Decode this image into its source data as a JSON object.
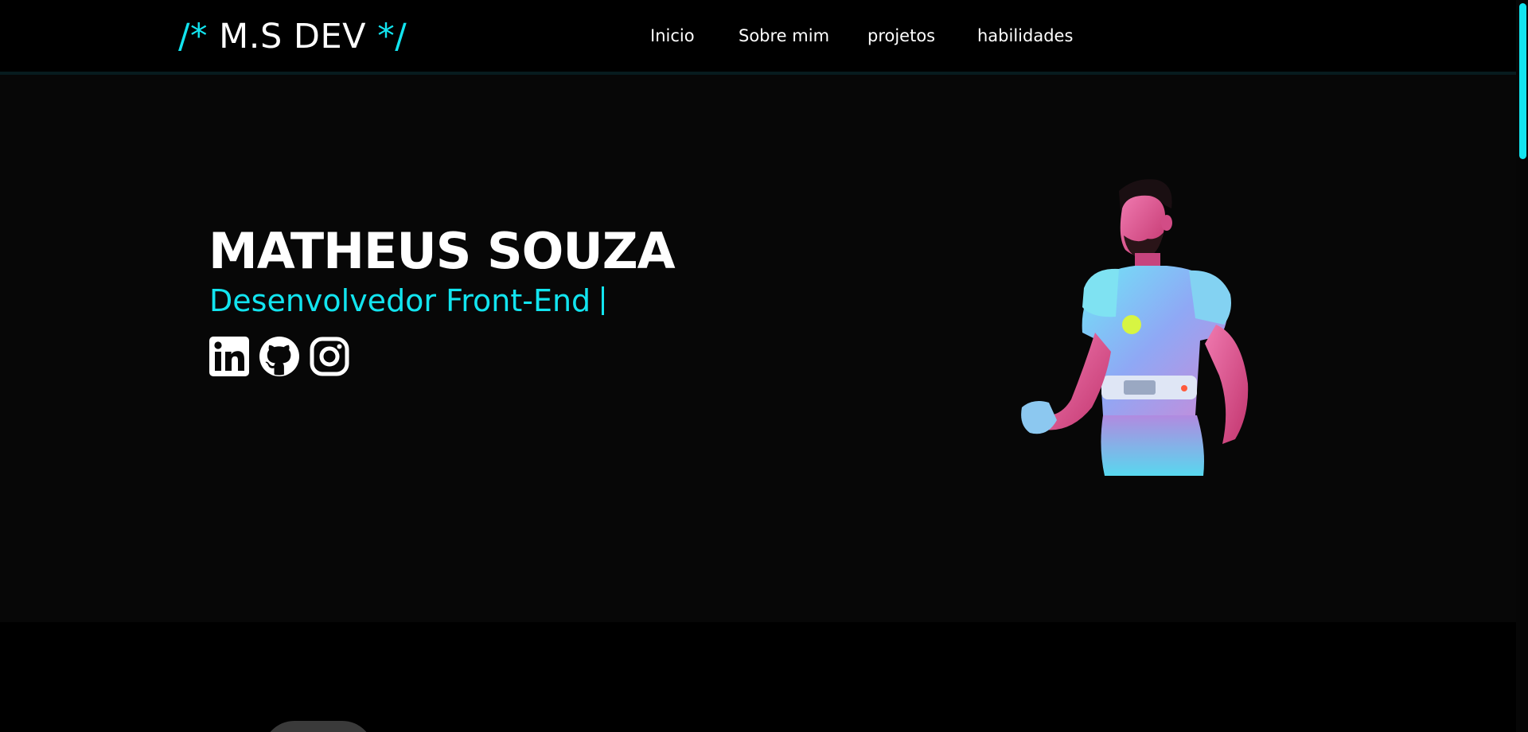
{
  "header": {
    "logo_open": "/*",
    "logo_text": "M.S DEV",
    "logo_close": "*/"
  },
  "nav": {
    "items": [
      {
        "label": "Inicio"
      },
      {
        "label": "Sobre mim"
      },
      {
        "label": "projetos"
      },
      {
        "label": "habilidades"
      }
    ]
  },
  "hero": {
    "name": "MATHEUS SOUZA",
    "role": "Desenvolvedor Front-End",
    "socials": [
      {
        "icon": "linkedin-icon"
      },
      {
        "icon": "github-icon"
      },
      {
        "icon": "instagram-icon"
      }
    ]
  },
  "colors": {
    "accent": "#12e4ef",
    "background": "#000000",
    "hero_background": "#070707",
    "text": "#ffffff"
  }
}
